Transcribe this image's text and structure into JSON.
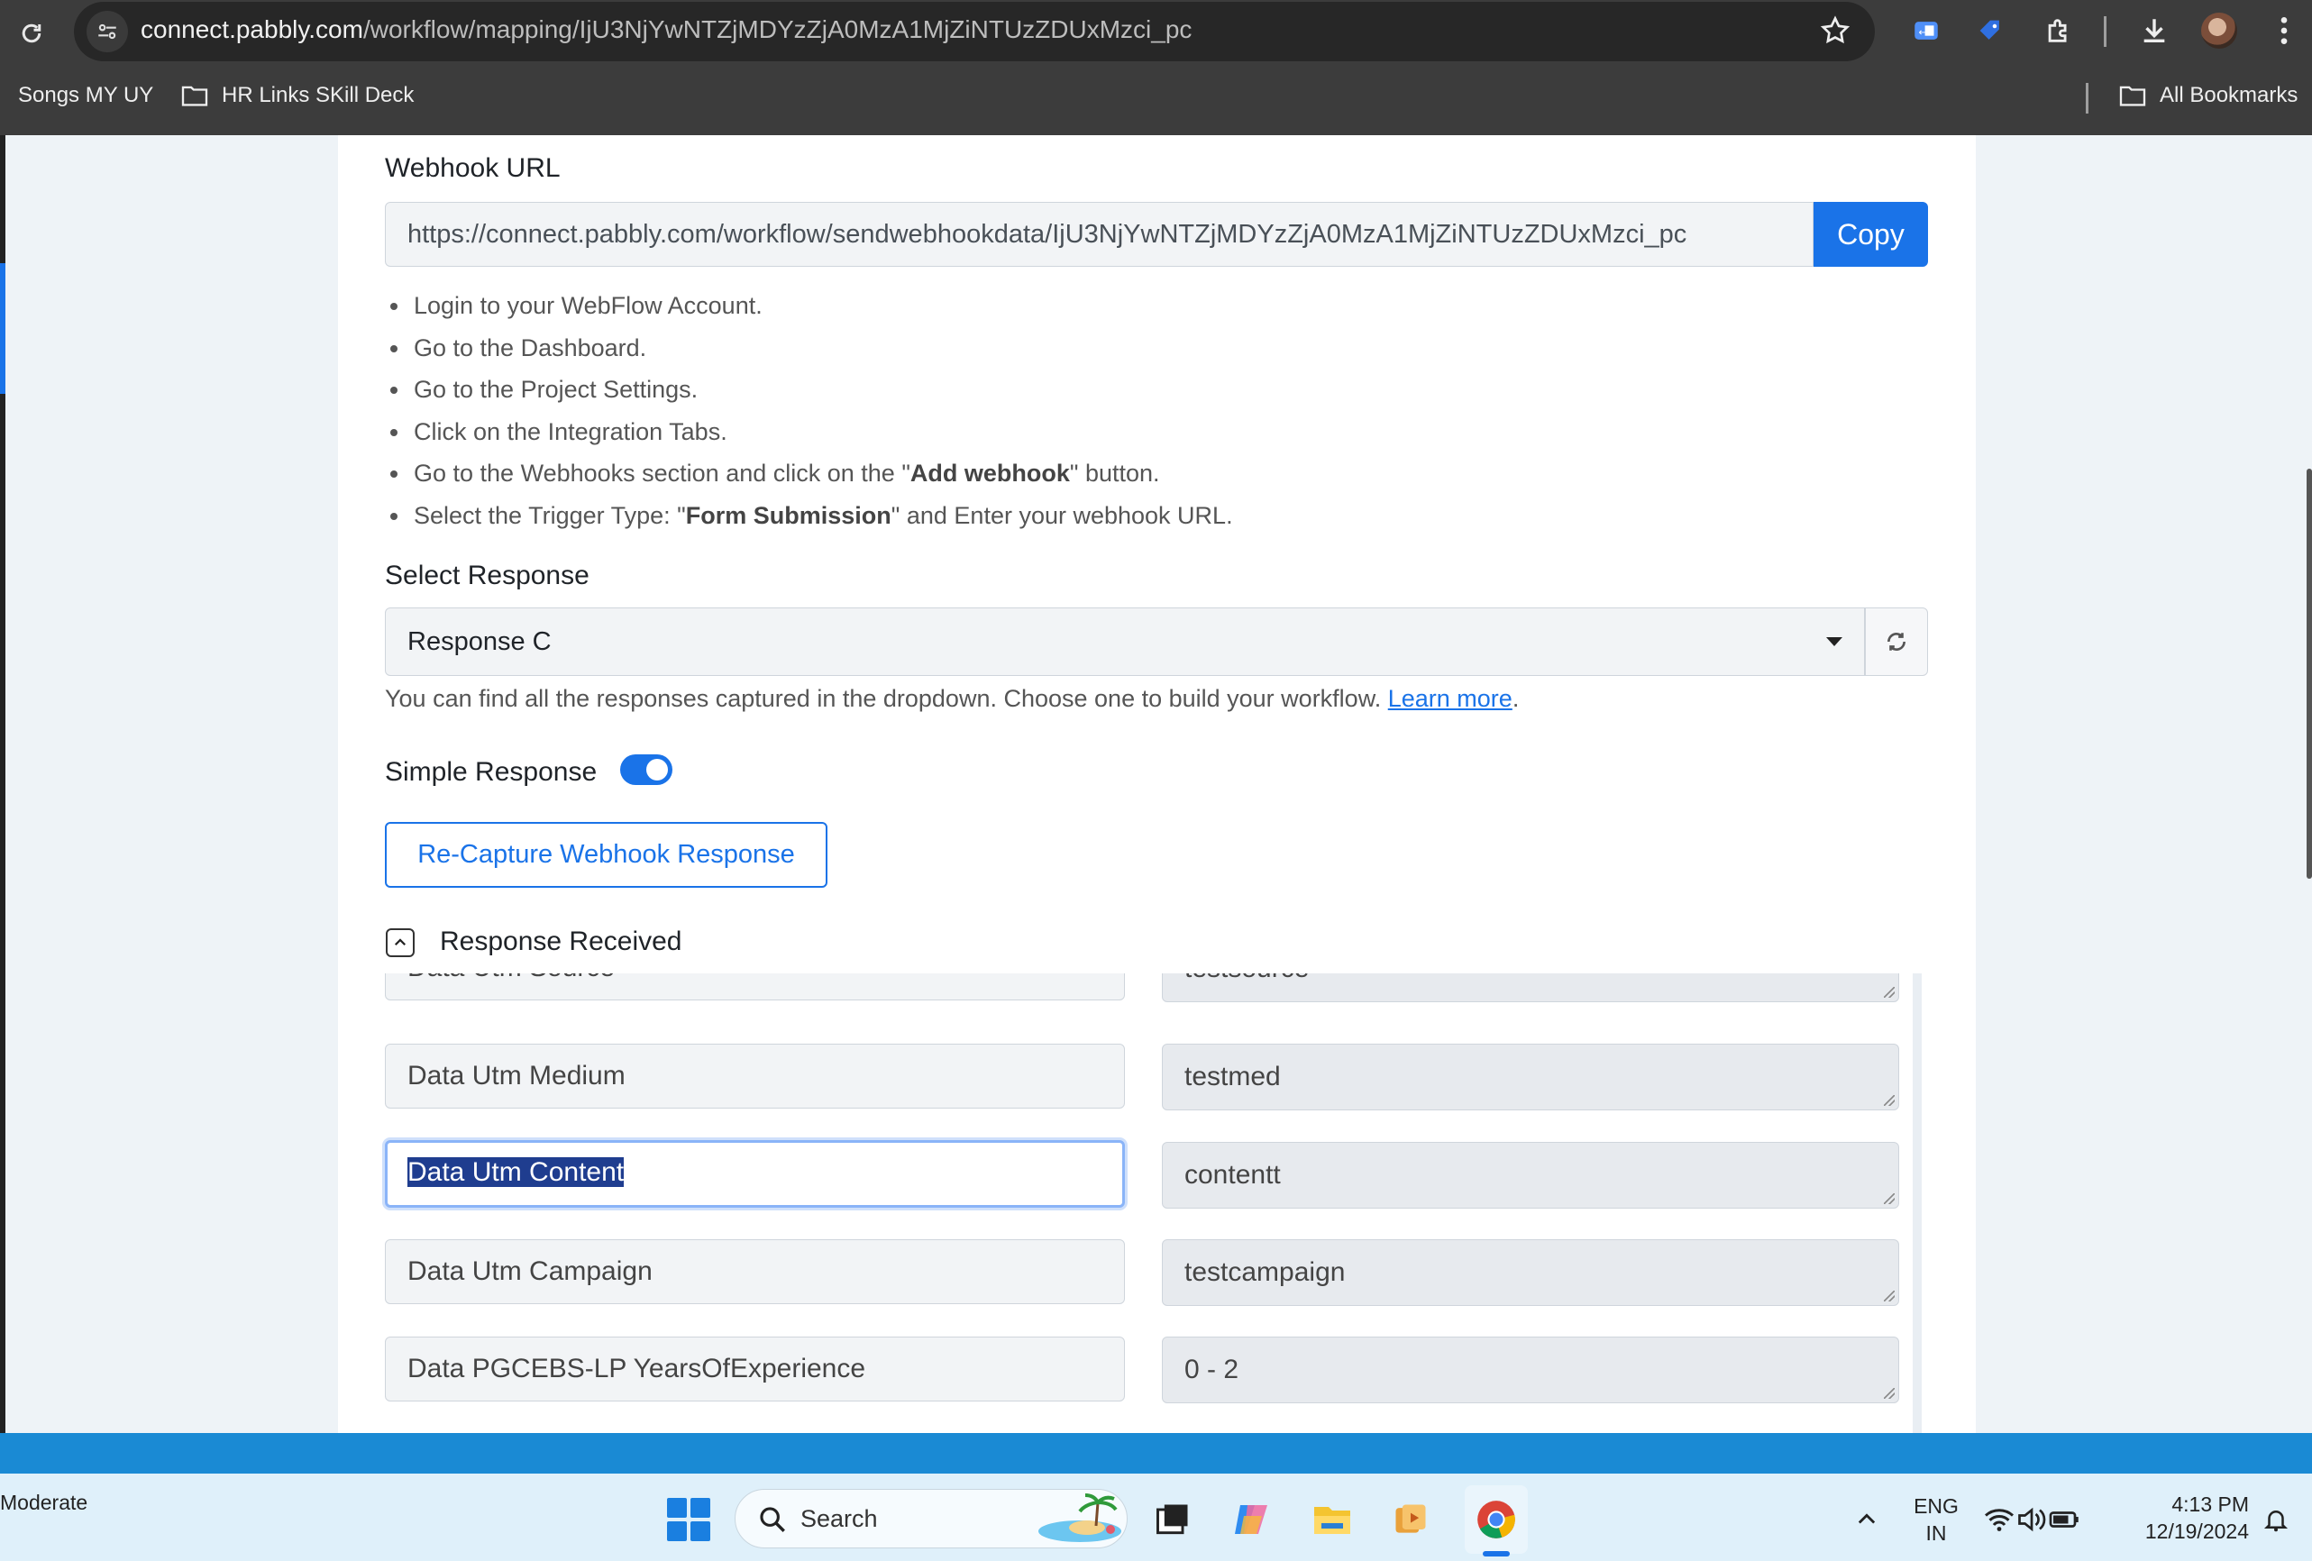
{
  "browser": {
    "url_host": "connect.pabbly.com",
    "url_path": "/workflow/mapping/IjU3NjYwNTZjMDYzZjA0MzA1MjZiNTUzZDUxMzci_pc",
    "bookmarks": [
      "Songs MY UY",
      "HR Links SKill Deck"
    ],
    "all_bookmarks": "All Bookmarks"
  },
  "webhook": {
    "label": "Webhook URL",
    "url_value": "https://connect.pabbly.com/workflow/sendwebhookdata/IjU3NjYwNTZjMDYzZjA0MzA1MjZiNTUzZDUxMzci_pc",
    "copy_label": "Copy"
  },
  "steps": {
    "s1": "Login to your WebFlow Account.",
    "s2": "Go to the Dashboard.",
    "s3": "Go to the Project Settings.",
    "s4": "Click on the Integration Tabs.",
    "s5_pre": "Go to the Webhooks section and click on the \"",
    "s5_bold": "Add webhook",
    "s5_post": "\" button.",
    "s6_pre": "Select the Trigger Type: \"",
    "s6_bold": "Form Submission",
    "s6_post": "\" and Enter your webhook URL."
  },
  "response": {
    "select_label": "Select Response",
    "selected": "Response C",
    "hint": "You can find all the responses captured in the dropdown. Choose one to build your workflow.",
    "learn_more": "Learn more",
    "hint_end": ".",
    "simple_label": "Simple Response",
    "simple_enabled": true,
    "recapture_label": "Re-Capture Webhook Response",
    "received_label": "Response Received",
    "rows": [
      {
        "key": "Data Utm Source",
        "value": "testsource"
      },
      {
        "key": "Data Utm Medium",
        "value": "testmed"
      },
      {
        "key": "Data Utm Content",
        "value": "contentt"
      },
      {
        "key": "Data Utm Campaign",
        "value": "testcampaign"
      },
      {
        "key": "Data PGCEBS-LP YearsOfExperience",
        "value": "0 - 2"
      }
    ]
  },
  "taskbar": {
    "weather": "Moderate",
    "search_placeholder": "Search",
    "lang_top": "ENG",
    "lang_bottom": "IN",
    "time": "4:13 PM",
    "date": "12/19/2024"
  },
  "colors": {
    "accent": "#1a73e8",
    "chrome_bar": "#3c3c3c",
    "taskbar": "#dff0fa"
  }
}
